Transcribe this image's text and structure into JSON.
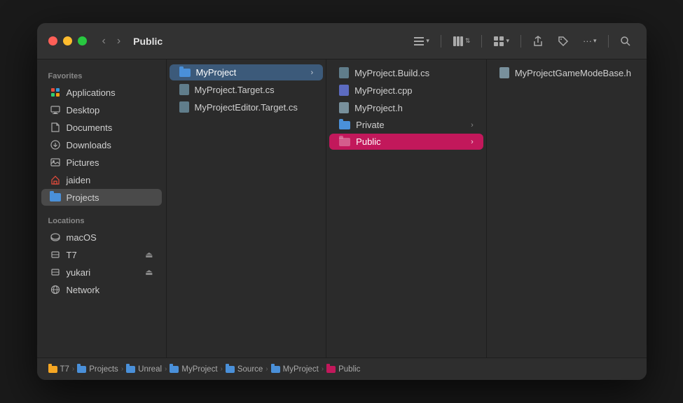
{
  "window": {
    "title": "Public"
  },
  "toolbar": {
    "back_label": "‹",
    "forward_label": "›",
    "list_view_label": "≡",
    "column_view_label": "⊞",
    "share_label": "↑",
    "tag_label": "⌀",
    "more_label": "···",
    "search_label": "⌕"
  },
  "sidebar": {
    "favorites_label": "Favorites",
    "locations_label": "Locations",
    "items": [
      {
        "id": "applications",
        "label": "Applications",
        "icon": "applications"
      },
      {
        "id": "desktop",
        "label": "Desktop",
        "icon": "desktop"
      },
      {
        "id": "documents",
        "label": "Documents",
        "icon": "documents"
      },
      {
        "id": "downloads",
        "label": "Downloads",
        "icon": "downloads"
      },
      {
        "id": "pictures",
        "label": "Pictures",
        "icon": "pictures"
      },
      {
        "id": "jaiden",
        "label": "jaiden",
        "icon": "home"
      },
      {
        "id": "projects",
        "label": "Projects",
        "icon": "folder",
        "active": true
      }
    ],
    "locations": [
      {
        "id": "macos",
        "label": "macOS",
        "icon": "disk"
      },
      {
        "id": "t7",
        "label": "T7",
        "icon": "disk-external",
        "eject": true
      },
      {
        "id": "yukari",
        "label": "yukari",
        "icon": "disk-external",
        "eject": true
      },
      {
        "id": "network",
        "label": "Network",
        "icon": "network"
      }
    ]
  },
  "pane1": {
    "items": [
      {
        "id": "myproject",
        "label": "MyProject",
        "type": "folder",
        "selected": true,
        "hasArrow": true
      },
      {
        "id": "myproject-target",
        "label": "MyProject.Target.cs",
        "type": "file-cs"
      },
      {
        "id": "myproject-editor",
        "label": "MyProjectEditor.Target.cs",
        "type": "file-cs"
      }
    ]
  },
  "pane2": {
    "items": [
      {
        "id": "myproject-build",
        "label": "MyProject.Build.cs",
        "type": "file-cs"
      },
      {
        "id": "myproject-cpp",
        "label": "MyProject.cpp",
        "type": "file-cpp"
      },
      {
        "id": "myproject-h",
        "label": "MyProject.h",
        "type": "file-h"
      },
      {
        "id": "private",
        "label": "Private",
        "type": "folder-blue",
        "hasArrow": true
      },
      {
        "id": "public",
        "label": "Public",
        "type": "folder-pink",
        "hasArrow": true,
        "selected": true
      }
    ]
  },
  "pane3": {
    "items": [
      {
        "id": "myprojectgamemode",
        "label": "MyProjectGameModeBase.h",
        "type": "file-h"
      }
    ]
  },
  "breadcrumb": {
    "items": [
      {
        "label": "T7",
        "type": "folder-yellow"
      },
      {
        "label": "Projects",
        "type": "folder-blue"
      },
      {
        "label": "Unreal",
        "type": "folder-blue"
      },
      {
        "label": "MyProject",
        "type": "folder-blue"
      },
      {
        "label": "Source",
        "type": "folder-blue"
      },
      {
        "label": "MyProject",
        "type": "folder-blue"
      },
      {
        "label": "Public",
        "type": "folder-pink"
      }
    ]
  }
}
